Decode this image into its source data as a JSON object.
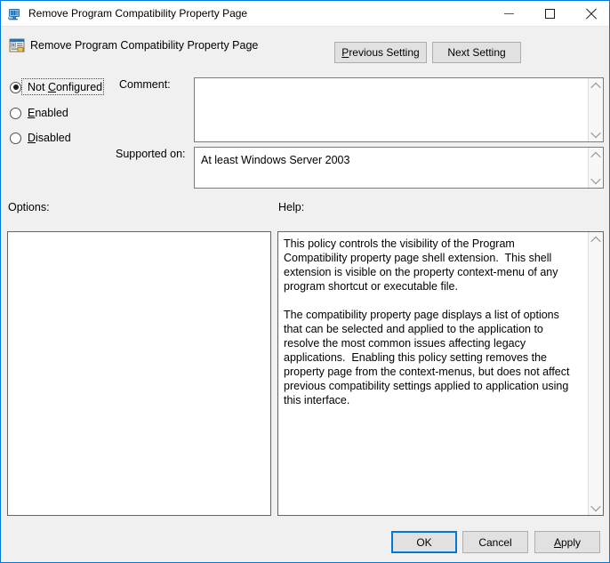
{
  "window": {
    "title": "Remove Program Compatibility Property Page",
    "icon": "computer-monitor-icon",
    "caption_buttons": {
      "minimize": "minimize-icon",
      "maximize": "maximize-icon",
      "close": "close-icon"
    },
    "accent_color": "#0078d7",
    "body_color": "#f0f0f0",
    "titlebar_color": "#ffffff"
  },
  "header": {
    "icon": "policy-setting-icon",
    "title": "Remove Program Compatibility Property Page",
    "previous_setting_label": "Previous Setting",
    "previous_setting_accel": "P",
    "next_setting_label": "Next Setting"
  },
  "state_options": [
    {
      "label": "Not Configured",
      "accel": "C",
      "selected": true,
      "focused": true
    },
    {
      "label": "Enabled",
      "accel": "E",
      "selected": false,
      "focused": false
    },
    {
      "label": "Disabled",
      "accel": "D",
      "selected": false,
      "focused": false
    }
  ],
  "fields": {
    "comment_label": "Comment:",
    "comment_value": "",
    "supported_on_label": "Supported on:",
    "supported_on_value": "At least Windows Server 2003"
  },
  "panels": {
    "options_label": "Options:",
    "options_content": "",
    "help_label": "Help:",
    "help_text": "This policy controls the visibility of the Program Compatibility property page shell extension.  This shell extension is visible on the property context-menu of any program shortcut or executable file.\n\nThe compatibility property page displays a list of options that can be selected and applied to the application to resolve the most common issues affecting legacy applications.  Enabling this policy setting removes the property page from the context-menus, but does not affect previous compatibility settings applied to application using this interface."
  },
  "footer": {
    "ok_label": "OK",
    "cancel_label": "Cancel",
    "apply_label": "Apply",
    "apply_accel": "A",
    "default_button": "OK"
  }
}
